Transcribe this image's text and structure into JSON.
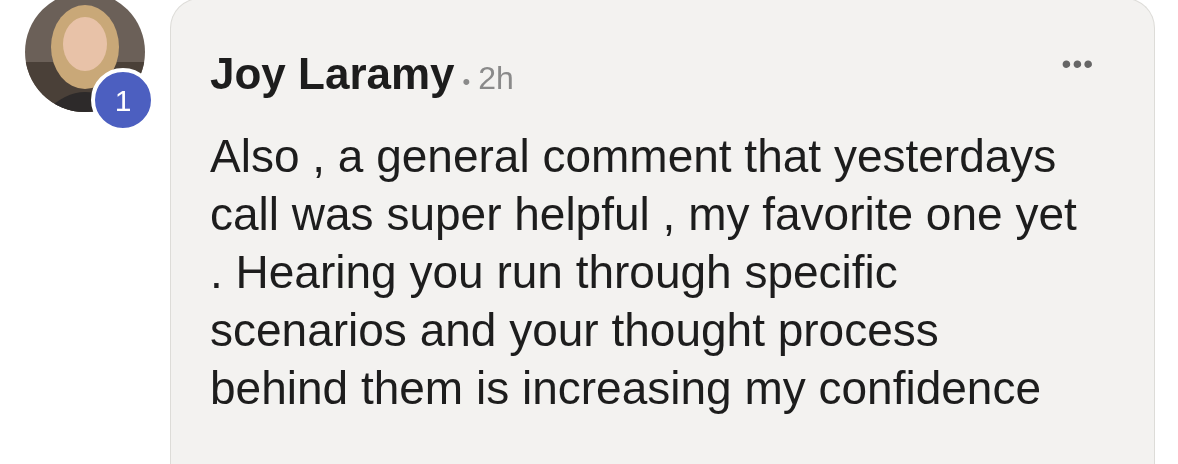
{
  "comment": {
    "author": "Joy Laramy",
    "separator": "•",
    "time": "2h",
    "menu": "•••",
    "badge": "1",
    "text": "Also , a general comment that yesterdays\ncall was super helpful , my favorite one yet\n. Hearing you run through specific\nscenarios and your thought process\nbehind them is increasing my confidence"
  }
}
